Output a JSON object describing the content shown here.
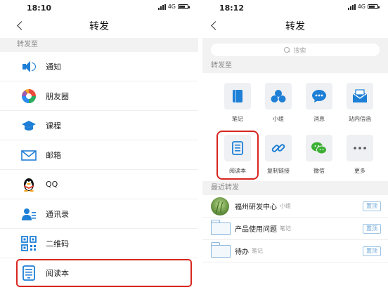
{
  "left": {
    "status": {
      "time": "18:10",
      "network": "4G"
    },
    "nav": {
      "title": "转发"
    },
    "section": "转发至",
    "items": [
      {
        "label": "通知"
      },
      {
        "label": "朋友圈"
      },
      {
        "label": "课程"
      },
      {
        "label": "邮箱"
      },
      {
        "label": "QQ"
      },
      {
        "label": "通讯录"
      },
      {
        "label": "二维码"
      },
      {
        "label": "阅读本"
      }
    ]
  },
  "right": {
    "status": {
      "time": "18:12",
      "network": "4G"
    },
    "nav": {
      "title": "转发"
    },
    "search": {
      "placeholder": "搜索"
    },
    "section": "转发至",
    "tiles": [
      {
        "label": "笔记"
      },
      {
        "label": "小组"
      },
      {
        "label": "消息"
      },
      {
        "label": "站内信函"
      },
      {
        "label": "阅读本"
      },
      {
        "label": "复制链接"
      },
      {
        "label": "微信"
      },
      {
        "label": "更多"
      }
    ],
    "recent_header": "最近转发",
    "recent": [
      {
        "name": "福州研发中心",
        "type": "小组",
        "action": "置顶"
      },
      {
        "name": "产品使用问题",
        "type": "笔记",
        "action": "置顶"
      },
      {
        "name": "待办",
        "type": "笔记",
        "action": "置顶"
      }
    ]
  },
  "colors": {
    "accent": "#1e7fd6",
    "highlight": "#d7261e",
    "section_bg": "#f2f2f2"
  }
}
